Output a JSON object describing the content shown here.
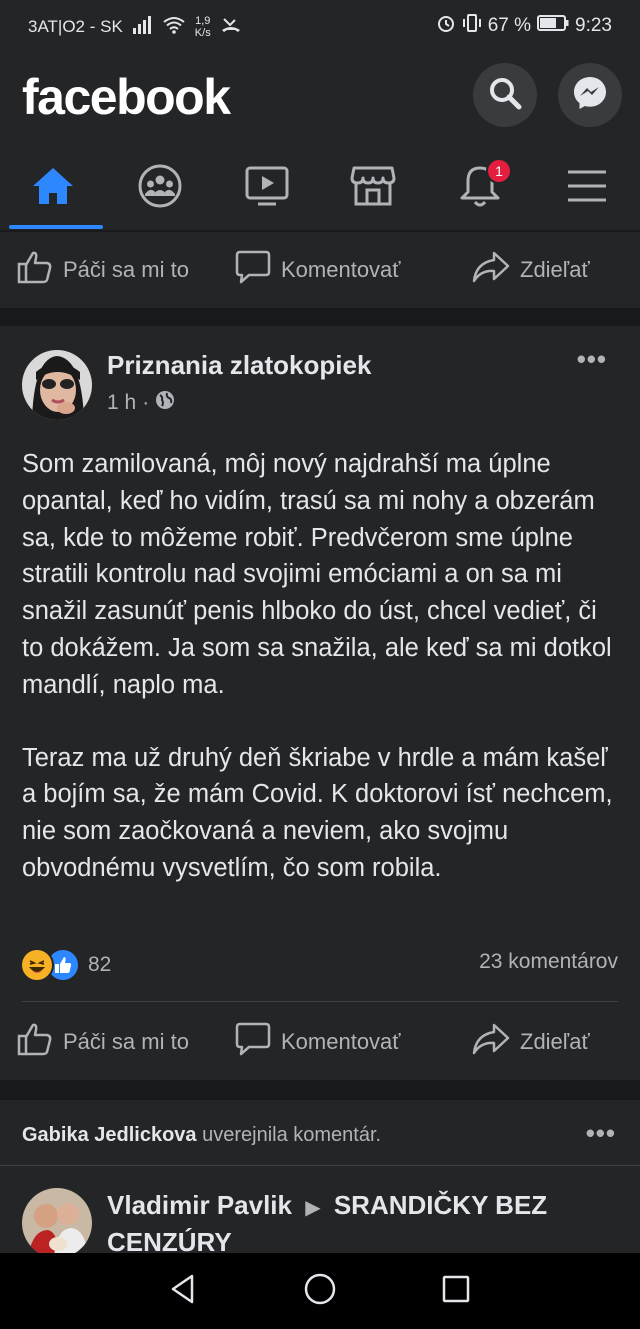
{
  "status_bar": {
    "carrier": "3AT|O2 - SK",
    "speed_value": "1,9",
    "speed_unit": "K/s",
    "battery": "67 %",
    "time": "9:23"
  },
  "header": {
    "logo": "facebook"
  },
  "tabs": {
    "notification_badge": "1"
  },
  "action_bar": {
    "like": "Páči sa mi to",
    "comment": "Komentovať",
    "share": "Zdieľať"
  },
  "post": {
    "author": "Priznania zlatokopiek",
    "time": "1 h",
    "paragraph_1": "Som zamilovaná, môj nový najdrahší ma úplne opantal, keď ho vidím, trasú sa mi nohy a obzerám sa, kde to môžeme robiť. Predvčerom sme úplne stratili kontrolu nad svojimi emóciami a on sa mi snažil zasunúť penis hlboko do úst, chcel vedieť, či to dokážem. Ja som sa snažila, ale keď sa mi dotkol mandlí, naplo ma.",
    "paragraph_2": "Teraz ma už druhý deň škriabe v hrdle a mám kašeľ a bojím sa, že mám Covid. K doktorovi ísť nechcem, nie som zaočkovaná a neviem, ako svojmu obvodnému vysvetlím, čo som robila.",
    "reaction_count": "82",
    "comment_count": "23 komentárov"
  },
  "activity": {
    "user": "Gabika Jedlickova",
    "action": "uverejnila komentár."
  },
  "post2": {
    "author": "Vladimir Pavlik",
    "group": "SRANDIČKY BEZ CENZÚRY"
  },
  "colors": {
    "accent": "#2d88ff",
    "background": "#18191a",
    "surface": "#242526",
    "badge": "#e41e3f"
  }
}
